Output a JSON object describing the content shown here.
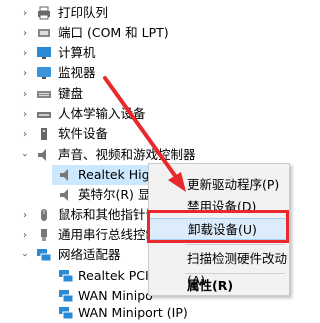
{
  "tree": {
    "items": [
      {
        "label": "打印队列",
        "expanded": false,
        "icon": "print-queue-icon"
      },
      {
        "label": "端口 (COM 和 LPT)",
        "expanded": false,
        "icon": "port-icon"
      },
      {
        "label": "计算机",
        "expanded": false,
        "icon": "computer-icon"
      },
      {
        "label": "监视器",
        "expanded": false,
        "icon": "monitor-icon"
      },
      {
        "label": "键盘",
        "expanded": false,
        "icon": "keyboard-icon"
      },
      {
        "label": "人体学输入设备",
        "expanded": false,
        "icon": "hid-icon"
      },
      {
        "label": "软件设备",
        "expanded": false,
        "icon": "software-device-icon"
      },
      {
        "label": "声音、视频和游戏控制器",
        "expanded": true,
        "icon": "speaker-icon"
      },
      {
        "label": "Realtek High Definition Audio",
        "child": true,
        "icon": "speaker-icon",
        "selected": true
      },
      {
        "label": "英特尔(R) 显示",
        "child": true,
        "icon": "speaker-icon"
      },
      {
        "label": "鼠标和其他指针设",
        "expanded": false,
        "icon": "mouse-icon"
      },
      {
        "label": "通用串行总线控制",
        "expanded": false,
        "icon": "usb-icon"
      },
      {
        "label": "网络适配器",
        "expanded": true,
        "icon": "network-adapter-icon"
      },
      {
        "label": "Realtek PCIe",
        "child": true,
        "icon": "network-adapter-icon"
      },
      {
        "label": "WAN Minipo",
        "child": true,
        "icon": "network-adapter-icon"
      },
      {
        "label": "WAN Miniport (IP)",
        "child": true,
        "icon": "network-adapter-icon"
      }
    ]
  },
  "context_menu": {
    "items": [
      {
        "label": "更新驱动程序(P)"
      },
      {
        "label": "禁用设备(D)"
      },
      {
        "label": "卸载设备(U)",
        "highlighted": true
      },
      {
        "label": "扫描检测硬件改动(A)"
      },
      {
        "label": "属性(R)",
        "bold": true
      }
    ]
  },
  "colors": {
    "annotation_red": "#e8282b",
    "selection_blue": "#cce8ff",
    "menu_highlight": "#dcecfc"
  }
}
